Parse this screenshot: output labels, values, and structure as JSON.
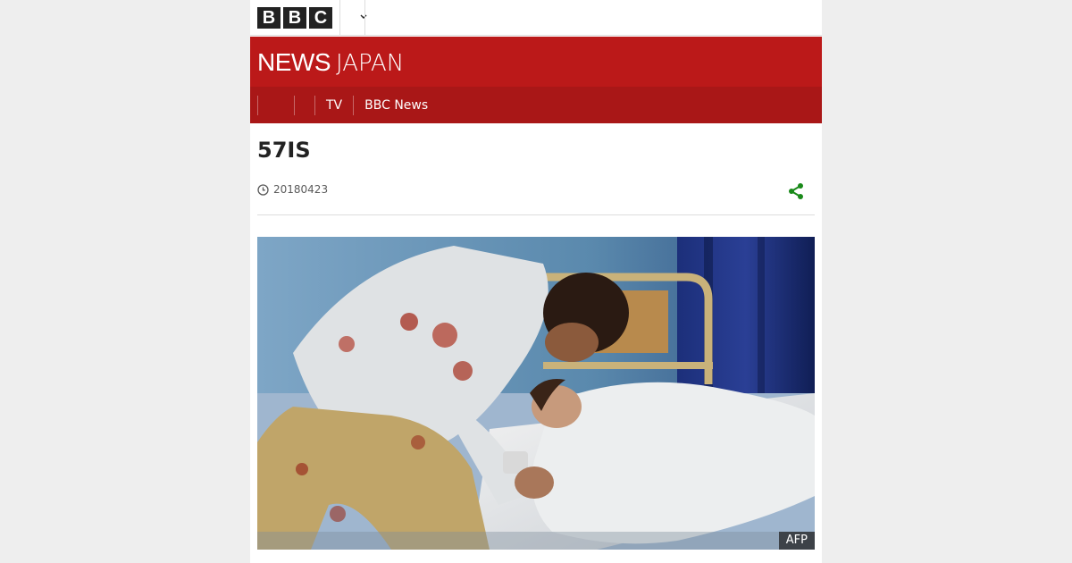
{
  "brand": {
    "logo_letters": [
      "B",
      "B",
      "C"
    ],
    "masthead_news": "NEWS",
    "masthead_region": "JAPAN",
    "accent_color": "#bb1919",
    "nav_color": "#a91717"
  },
  "topbar": {
    "more_icon": "chevron-down-icon"
  },
  "nav": {
    "items": [
      {
        "label": ""
      },
      {
        "label": ""
      },
      {
        "label": "TV"
      },
      {
        "label": "BBC News"
      }
    ]
  },
  "article": {
    "headline": "57IS",
    "date": "20180423",
    "date_icon": "clock-icon",
    "share_icon": "share-icon",
    "share_color": "#1a8a1a"
  },
  "image": {
    "credit": "AFP"
  }
}
